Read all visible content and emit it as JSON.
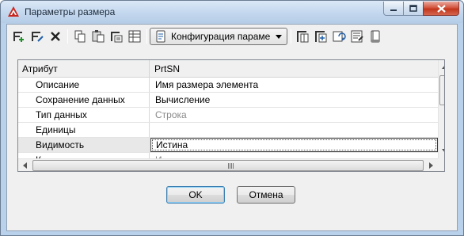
{
  "window": {
    "title": "Параметры размера"
  },
  "toolbar": {
    "buttons": [
      {
        "icon": "add-parameter-icon"
      },
      {
        "icon": "edit-parameter-icon"
      },
      {
        "icon": "delete-icon"
      },
      {
        "icon": "copy-icon"
      },
      {
        "icon": "paste-icon"
      },
      {
        "icon": "insert-row-icon"
      },
      {
        "icon": "table-view-icon"
      },
      {
        "icon": "configuration-icon"
      },
      {
        "icon": "column-settings-icon"
      },
      {
        "icon": "add-column-icon"
      },
      {
        "icon": "refresh-icon"
      },
      {
        "icon": "properties-icon"
      },
      {
        "icon": "book-icon"
      }
    ],
    "config_dropdown": {
      "label": "Конфигурация параме"
    }
  },
  "grid": {
    "headers": {
      "attribute": "Атрибут",
      "value": "PrtSN"
    },
    "rows": [
      {
        "name": "Описание",
        "value": "Имя размера элемента",
        "disabled": false
      },
      {
        "name": "Сохранение данных",
        "value": "Вычисление",
        "disabled": false
      },
      {
        "name": "Тип данных",
        "value": "Строка",
        "disabled": true
      },
      {
        "name": "Единицы",
        "value": "",
        "disabled": false
      },
      {
        "name": "Видимость",
        "value": "Истина",
        "disabled": false,
        "selected": true
      },
      {
        "name": "К",
        "value": "И",
        "disabled": true
      }
    ]
  },
  "buttons": {
    "ok": "OK",
    "cancel": "Отмена"
  },
  "colors": {
    "close_button": "#c1361c",
    "selection_border": "#3a3a3a",
    "window_frame": "#b9d1ea"
  }
}
